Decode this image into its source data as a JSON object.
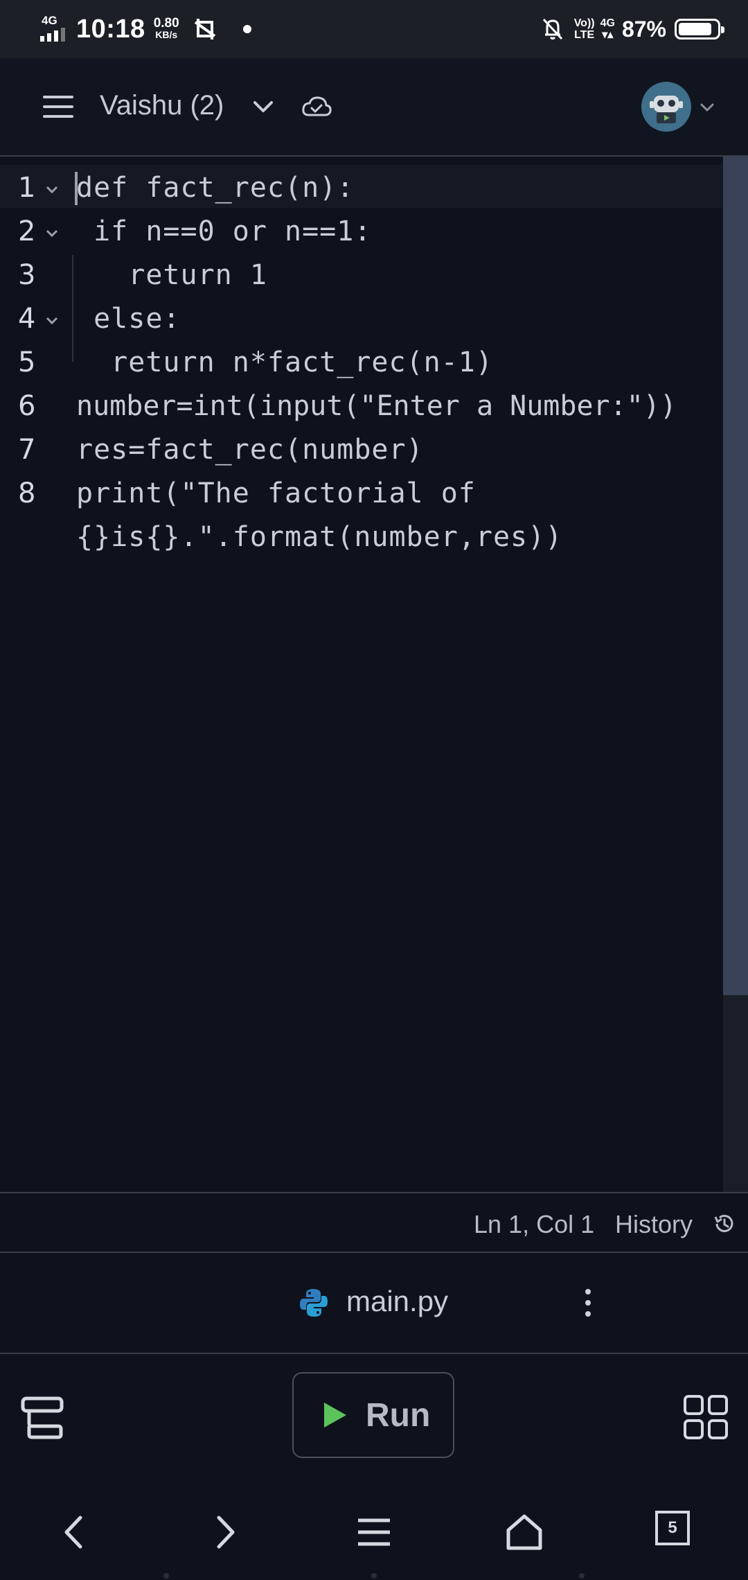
{
  "status_bar": {
    "network": "4G",
    "time": "10:18",
    "speed_value": "0.80",
    "speed_unit": "KB/s",
    "volte": "Vo))",
    "lte": "LTE",
    "net_right": "4G",
    "battery_pct": "87%",
    "battery_level": 0.87
  },
  "header": {
    "project_title": "Vaishu (2)"
  },
  "editor": {
    "lines": [
      {
        "num": "1",
        "code": "def fact_rec(n):"
      },
      {
        "num": "2",
        "code": " if n==0 or n==1:"
      },
      {
        "num": "3",
        "code": "   return 1"
      },
      {
        "num": "4",
        "code": " else:"
      },
      {
        "num": "5",
        "code": "  return n*fact_rec(n-1)"
      },
      {
        "num": "6",
        "code": "number=int(input(\"Enter a Number:\"))"
      },
      {
        "num": "7",
        "code": "res=fact_rec(number)"
      },
      {
        "num": "8",
        "code": "print(\"The factorial of"
      },
      {
        "num": "",
        "code": "{}is{}.\".format(number,res))"
      }
    ]
  },
  "editor_status": {
    "cursor_position": "Ln 1, Col 1",
    "history_label": "History"
  },
  "file_tab": {
    "filename": "main.py"
  },
  "toolbar": {
    "run_label": "Run"
  },
  "navbar": {
    "tab_count": "5"
  },
  "colors": {
    "background": "#0f121c",
    "text": "#c9cdd6",
    "run_green": "#5cc35c"
  }
}
